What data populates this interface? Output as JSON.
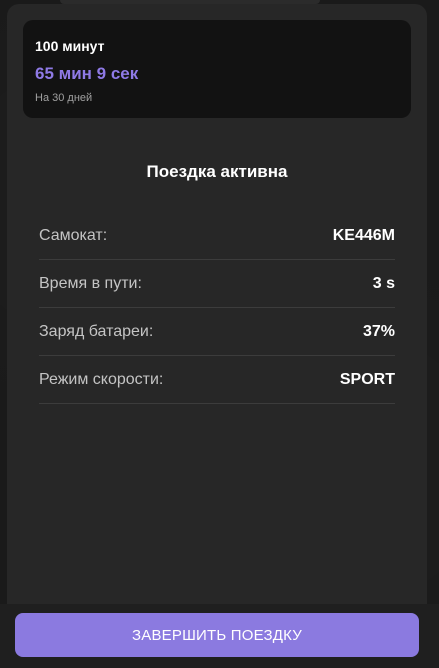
{
  "plan": {
    "title": "100 минут",
    "remaining": "65 мин 9 сек",
    "period": "На 30 дней"
  },
  "ride": {
    "title": "Поездка активна",
    "rows": [
      {
        "label": "Самокат:",
        "value": "KE446M"
      },
      {
        "label": "Время в пути:",
        "value": "3 s"
      },
      {
        "label": "Заряд батареи:",
        "value": "37%"
      },
      {
        "label": "Режим скорости:",
        "value": "SPORT"
      }
    ]
  },
  "actions": {
    "end_ride_label": "ЗАВЕРШИТЬ ПОЕЗДКУ"
  },
  "colors": {
    "accent": "#8b7ae0",
    "accent_text": "#8f7ae6",
    "background": "#1a1a1a",
    "card": "#272727"
  }
}
